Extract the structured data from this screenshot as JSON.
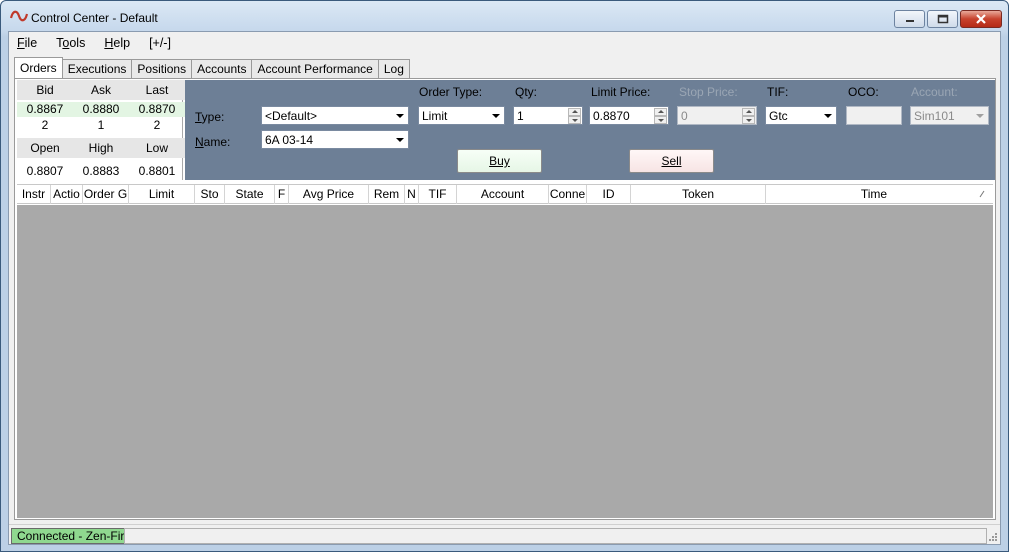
{
  "window": {
    "title": "Control Center - Default"
  },
  "menu": {
    "items": [
      {
        "label": "File",
        "ul": "F",
        "rest": "ile"
      },
      {
        "label": "Tools",
        "ul": "o",
        "pre": "T",
        "rest": "ols"
      },
      {
        "label": "Help",
        "ul": "H",
        "rest": "elp"
      },
      {
        "label": "[+/-]"
      }
    ]
  },
  "tabs": [
    "Orders",
    "Executions",
    "Positions",
    "Accounts",
    "Account Performance",
    "Log"
  ],
  "quote": {
    "bid_label": "Bid",
    "ask_label": "Ask",
    "last_label": "Last",
    "bid": "0.8867",
    "ask": "0.8880",
    "last": "0.8870",
    "bid_size": "2",
    "ask_size": "1",
    "last_size": "2",
    "open_label": "Open",
    "high_label": "High",
    "low_label": "Low",
    "open": "0.8807",
    "high": "0.8883",
    "low": "0.8801"
  },
  "order": {
    "type_label": "Type:",
    "type_value": "<Default>",
    "name_label": "Name:",
    "name_value": "6A 03-14",
    "order_type_label": "Order Type:",
    "order_type_value": "Limit",
    "qty_label": "Qty:",
    "qty_value": "1",
    "limit_price_label": "Limit Price:",
    "limit_price_value": "0.8870",
    "stop_price_label": "Stop Price:",
    "stop_price_value": "0",
    "tif_label": "TIF:",
    "tif_value": "Gtc",
    "oco_label": "OCO:",
    "oco_value": "",
    "account_label": "Account:",
    "account_value": "Sim101",
    "buy_label": "Buy",
    "sell_label": "Sell"
  },
  "grid": {
    "columns": [
      "Instr",
      "Actio",
      "Order G",
      "Limit",
      "Sto",
      "State",
      "F",
      "Avg Price",
      "Rem",
      "N",
      "TIF",
      "Account",
      "Conne",
      "ID",
      "Token",
      "Time"
    ]
  },
  "status": {
    "connection": "Connected - Zen-Fire",
    "connection_color": "#8fd88f"
  },
  "colors": {
    "order_panel_bg": "#6d7f96",
    "grid_body_bg": "#a9a9a9"
  }
}
